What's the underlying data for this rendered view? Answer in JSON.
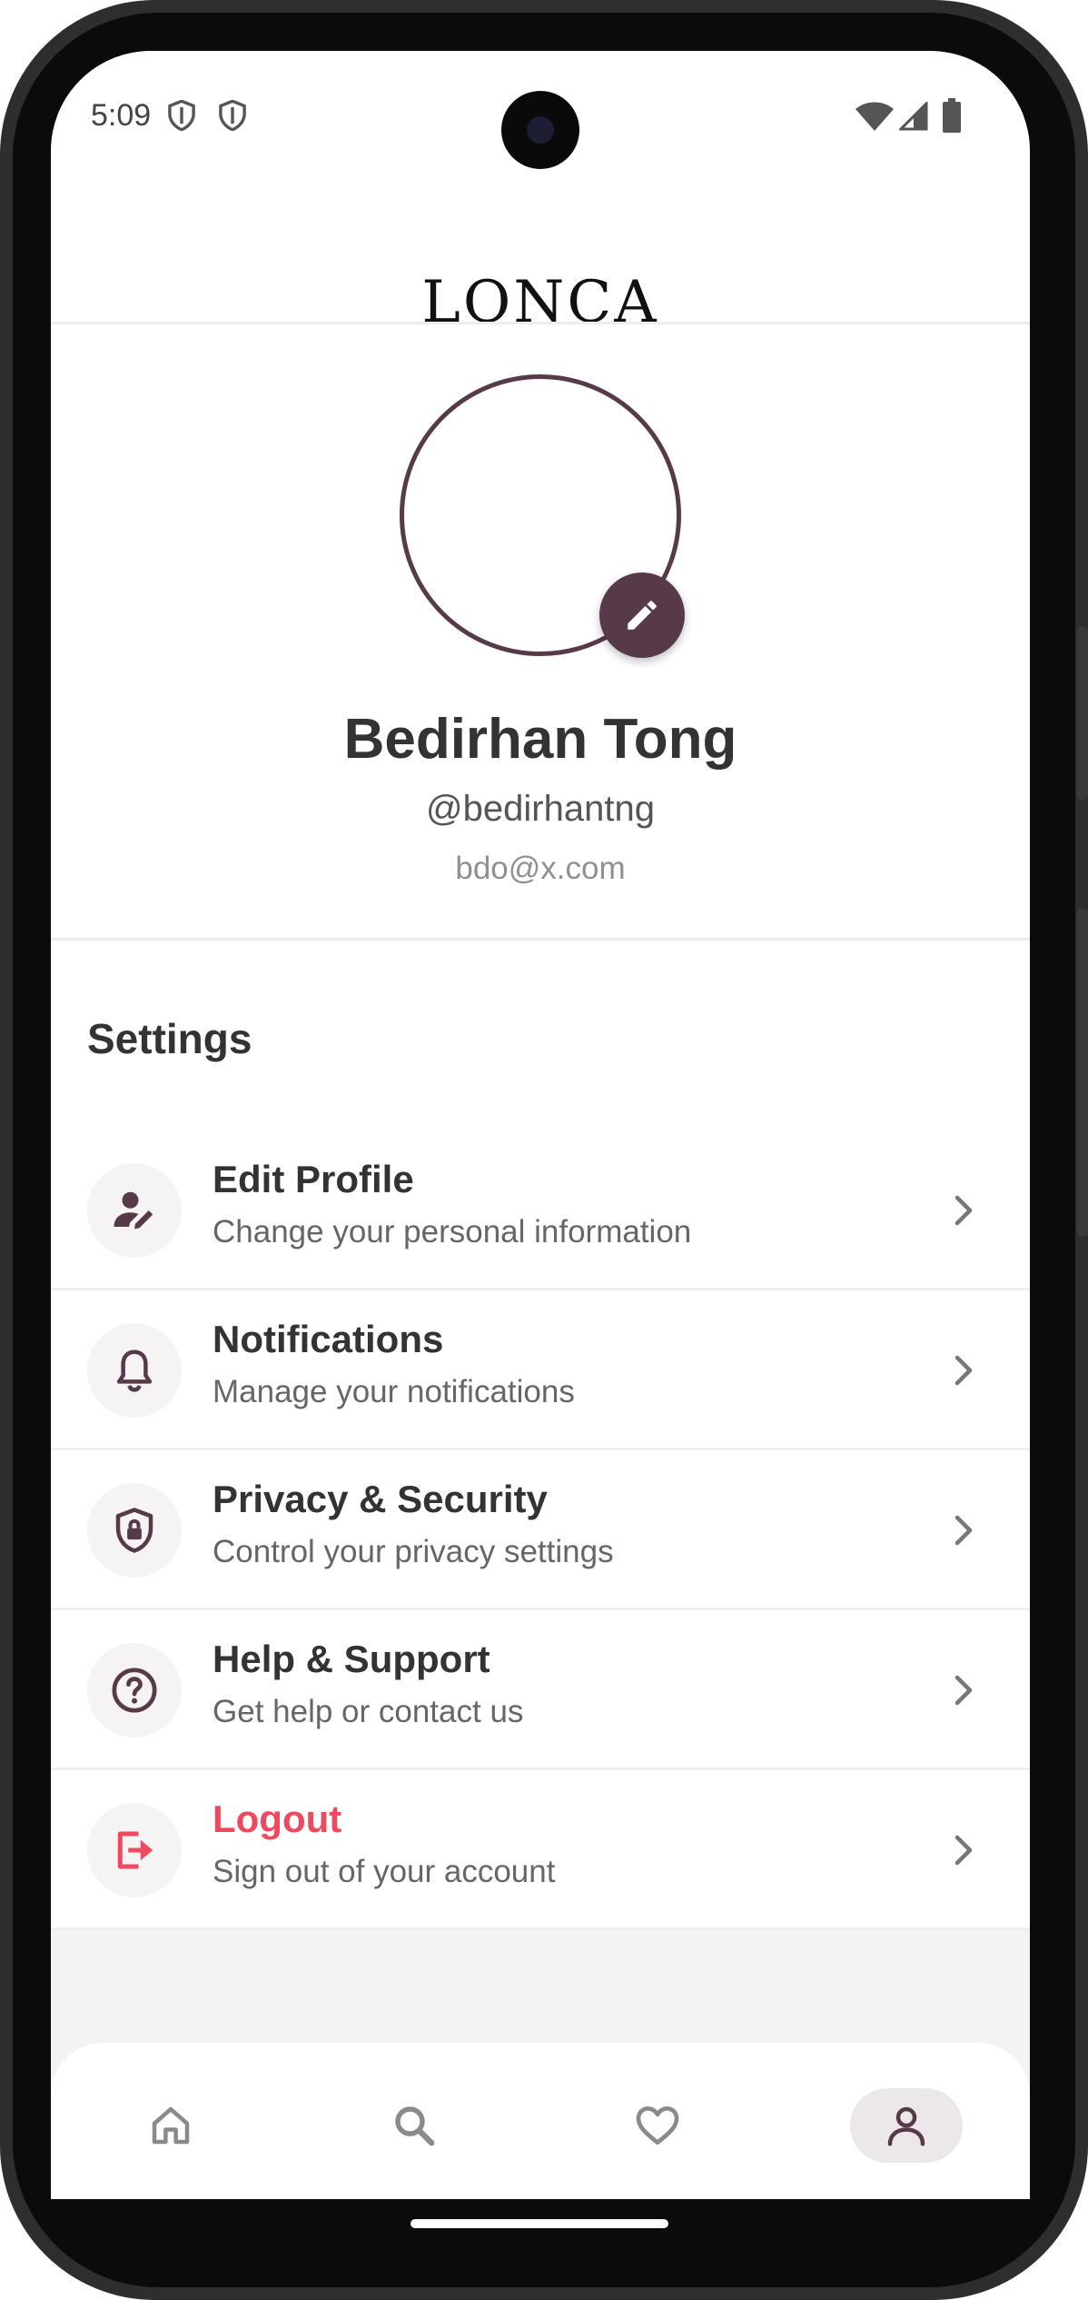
{
  "status_bar": {
    "time": "5:09"
  },
  "header": {
    "logo": "LONCA"
  },
  "profile": {
    "name": "Bedirhan Tong",
    "handle": "@bedirhantng",
    "email": "bdo@x.com"
  },
  "settings": {
    "title": "Settings",
    "items": [
      {
        "title": "Edit Profile",
        "subtitle": "Change your personal information",
        "icon": "edit-person-icon"
      },
      {
        "title": "Notifications",
        "subtitle": "Manage your notifications",
        "icon": "bell-icon"
      },
      {
        "title": "Privacy & Security",
        "subtitle": "Control your privacy settings",
        "icon": "shield-lock-icon"
      },
      {
        "title": "Help & Support",
        "subtitle": "Get help or contact us",
        "icon": "help-circle-icon"
      },
      {
        "title": "Logout",
        "subtitle": "Sign out of your account",
        "icon": "logout-icon"
      }
    ]
  },
  "bottom_nav": {
    "items": [
      "home",
      "search",
      "favorites",
      "profile"
    ],
    "active": "profile"
  },
  "colors": {
    "accent": "#573a4a",
    "danger": "#f0495f",
    "text": "#333333"
  }
}
